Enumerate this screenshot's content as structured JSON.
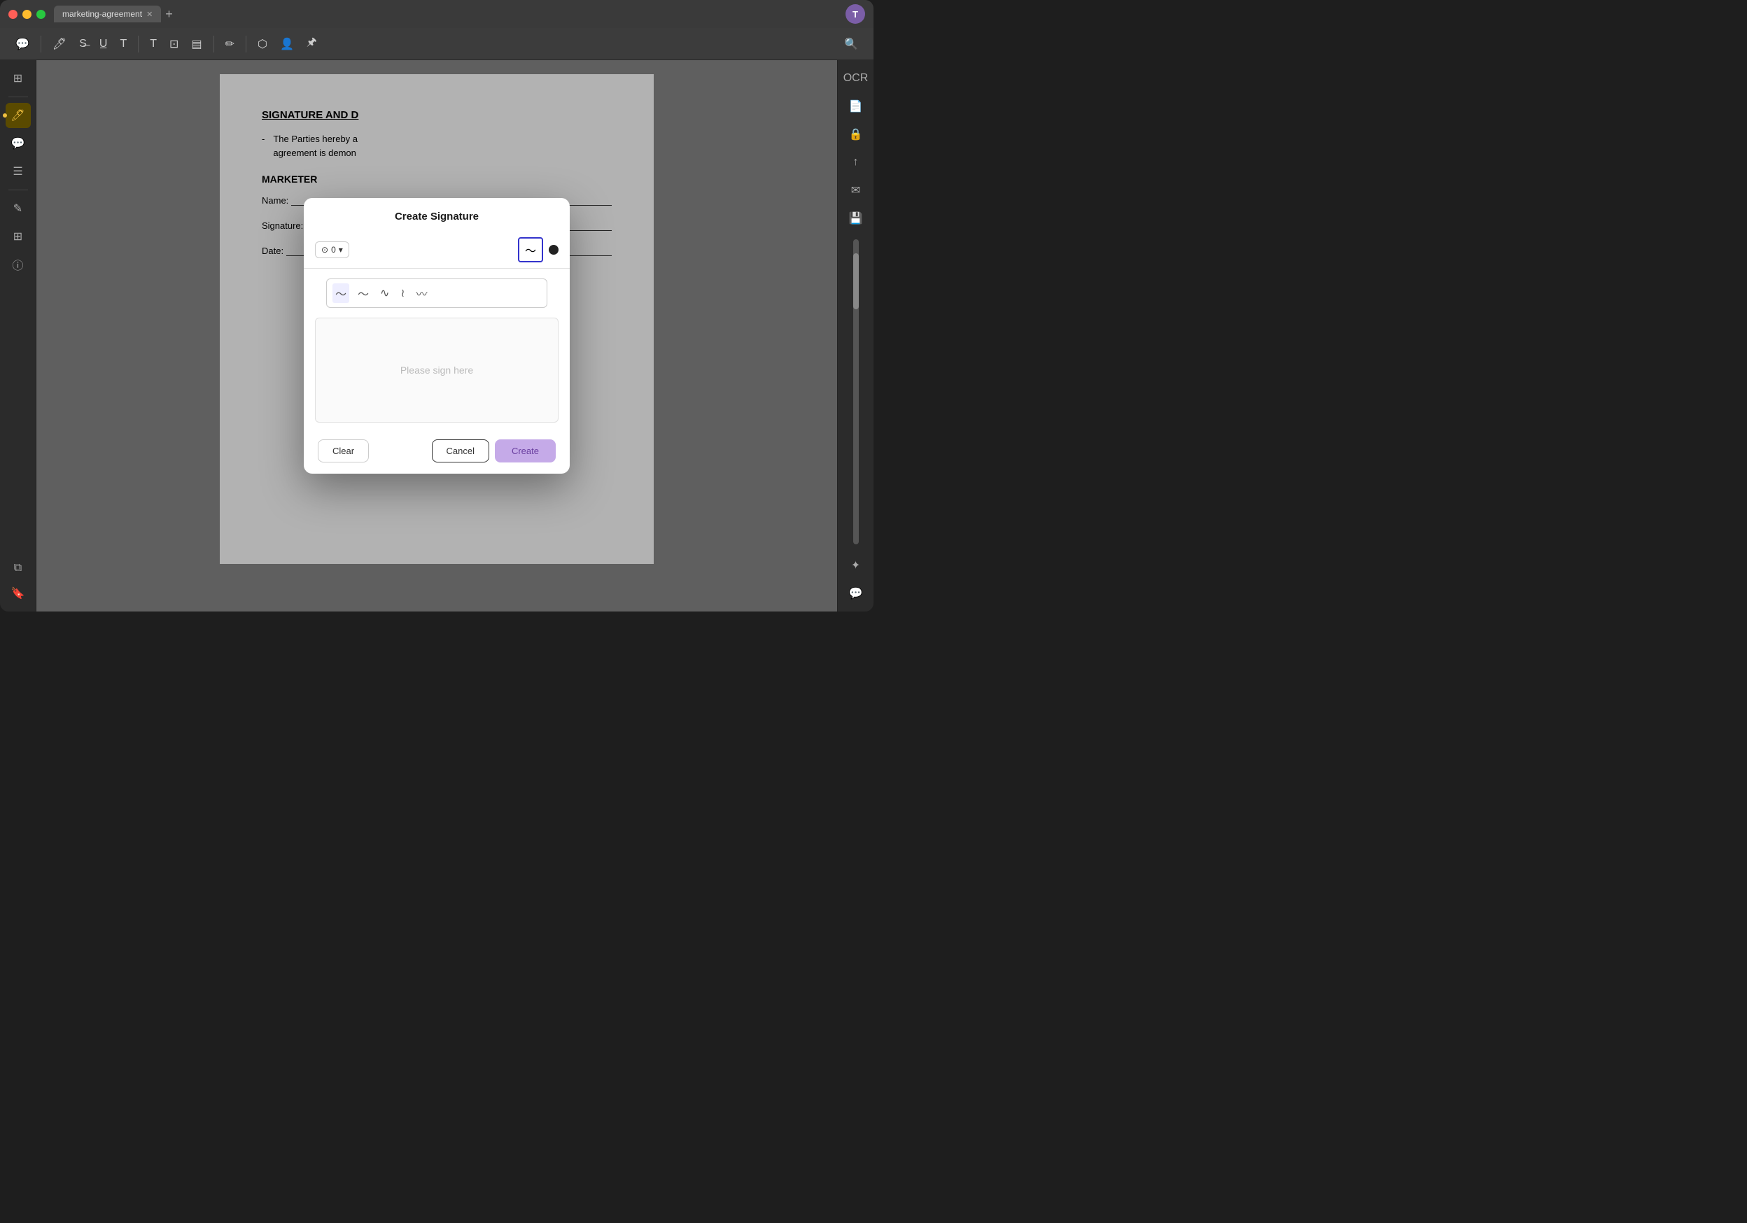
{
  "window": {
    "title": "marketing-agreement",
    "tab_label": "marketing-agreement"
  },
  "avatar": {
    "letter": "T",
    "color": "#7b5ea7"
  },
  "toolbar": {
    "icons": [
      "comment",
      "highlight",
      "strikethrough",
      "underline",
      "text",
      "freetext",
      "textbox",
      "note",
      "draw",
      "shapes",
      "person",
      "stamp"
    ]
  },
  "document": {
    "section_title": "SIGNATURE AND D",
    "list_item_text": "The Parties hereby a",
    "list_item_text2": "agreement is demon",
    "section_label": "MARKETER",
    "field_name": "Name:",
    "field_signature": "Signature:",
    "field_date": "Date:"
  },
  "modal": {
    "title": "Create Signature",
    "tool_label": "0",
    "pen_style_options": [
      "~",
      "~",
      "~",
      "~",
      "~"
    ],
    "sign_placeholder": "Please sign here",
    "buttons": {
      "clear": "Clear",
      "cancel": "Cancel",
      "create": "Create"
    }
  },
  "sidebar": {
    "icons": [
      "panel",
      "highlight",
      "comment",
      "list",
      "edit",
      "layers",
      "bookmark"
    ]
  }
}
